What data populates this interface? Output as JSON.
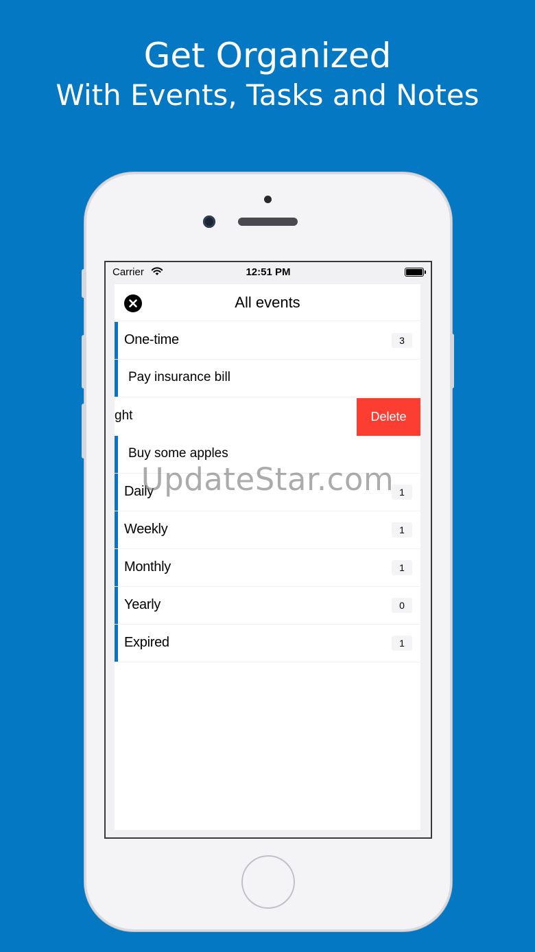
{
  "promo": {
    "title": "Get Organized",
    "subtitle": "With Events, Tasks and Notes"
  },
  "status_bar": {
    "carrier": "Carrier",
    "time": "12:51 PM"
  },
  "nav": {
    "title": "All events"
  },
  "list": {
    "rows": [
      {
        "label": "One-time",
        "count": "3"
      },
      {
        "label": "Pay insurance bill"
      },
      {
        "label": "ght",
        "action": "Delete"
      },
      {
        "label": "Buy some apples"
      },
      {
        "label": "Daily",
        "count": "1"
      },
      {
        "label": "Weekly",
        "count": "1"
      },
      {
        "label": "Monthly",
        "count": "1"
      },
      {
        "label": "Yearly",
        "count": "0"
      },
      {
        "label": "Expired",
        "count": "1"
      }
    ]
  },
  "watermark": "UpdateStar.com",
  "colors": {
    "background": "#0478c2",
    "accent": "#0a72c7",
    "delete": "#fb3d32"
  }
}
